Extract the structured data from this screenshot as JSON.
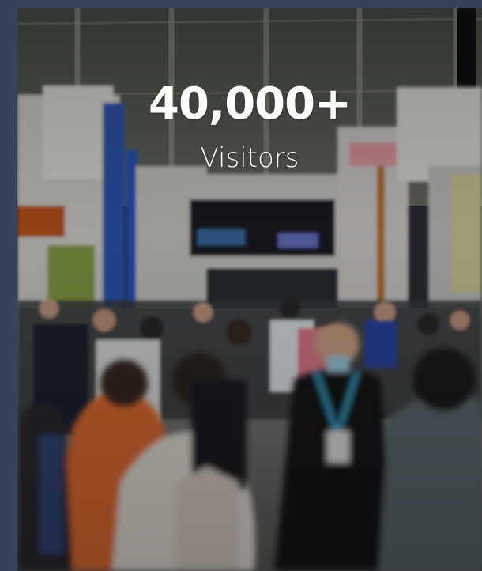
{
  "stat": {
    "number": "40,000+",
    "label": "Visitors"
  },
  "colors": {
    "page_background": "#35435c",
    "text": "#ffffff"
  },
  "image": {
    "semantic": "crowd-photo"
  }
}
